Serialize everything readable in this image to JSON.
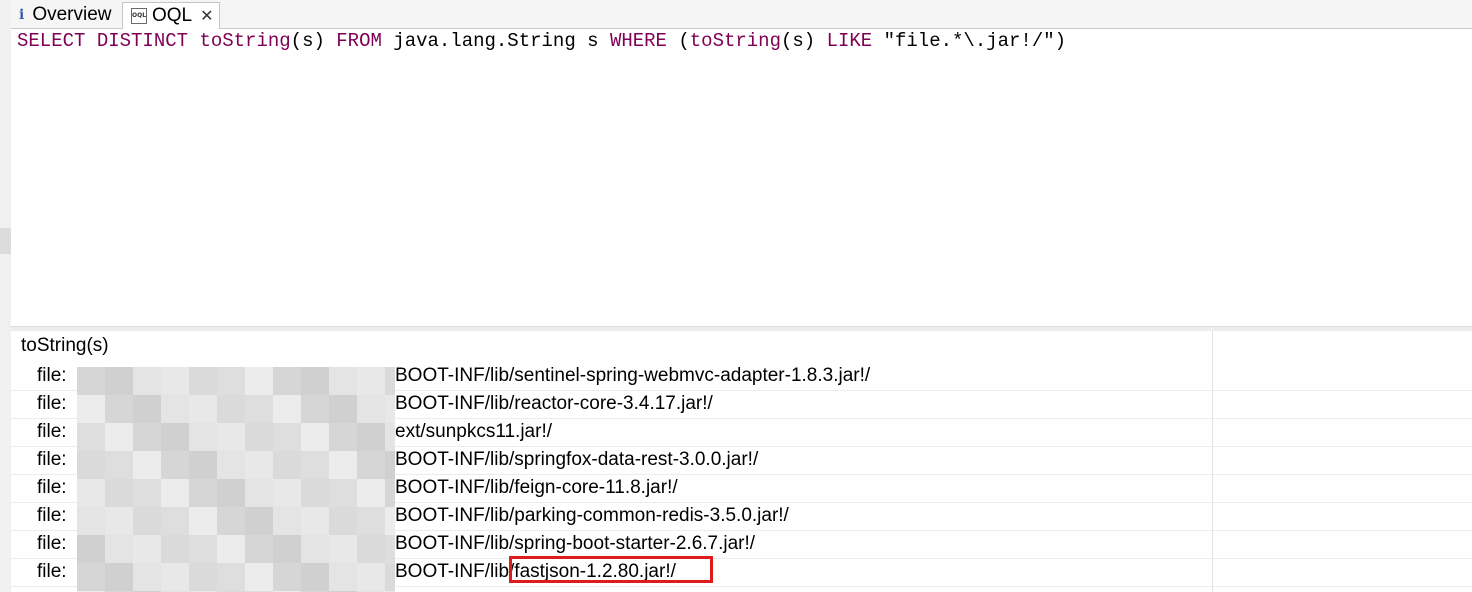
{
  "tabs": [
    {
      "label": "Overview",
      "icon": "info-icon",
      "active": false
    },
    {
      "label": "OQL",
      "icon": "oql-file-icon",
      "active": true,
      "closable": true
    }
  ],
  "editor": {
    "tokens": [
      {
        "text": "SELECT",
        "kind": "kw"
      },
      {
        "text": " ",
        "kind": "plain"
      },
      {
        "text": "DISTINCT",
        "kind": "kw"
      },
      {
        "text": " ",
        "kind": "plain"
      },
      {
        "text": "toString",
        "kind": "fn"
      },
      {
        "text": "(s) ",
        "kind": "plain"
      },
      {
        "text": "FROM",
        "kind": "kw"
      },
      {
        "text": " java.lang.String s ",
        "kind": "plain"
      },
      {
        "text": "WHERE",
        "kind": "kw"
      },
      {
        "text": " (",
        "kind": "plain"
      },
      {
        "text": "toString",
        "kind": "fn"
      },
      {
        "text": "(s) ",
        "kind": "plain"
      },
      {
        "text": "LIKE",
        "kind": "kw"
      },
      {
        "text": " \"file.*\\.jar!/\")",
        "kind": "str"
      }
    ]
  },
  "results": {
    "column_header": "toString(s)",
    "rows": [
      {
        "prefix": "file:",
        "value": "BOOT-INF/lib/sentinel-spring-webmvc-adapter-1.8.3.jar!/"
      },
      {
        "prefix": "file:",
        "value": "BOOT-INF/lib/reactor-core-3.4.17.jar!/"
      },
      {
        "prefix": "file:",
        "value": "ext/sunpkcs11.jar!/"
      },
      {
        "prefix": "file:",
        "value": "BOOT-INF/lib/springfox-data-rest-3.0.0.jar!/"
      },
      {
        "prefix": "file:",
        "value": "BOOT-INF/lib/feign-core-11.8.jar!/"
      },
      {
        "prefix": "file:",
        "value": "BOOT-INF/lib/parking-common-redis-3.5.0.jar!/"
      },
      {
        "prefix": "file:",
        "value": "BOOT-INF/lib/spring-boot-starter-2.6.7.jar!/"
      },
      {
        "prefix": "file:",
        "value": "BOOT-INF/lib/fastjson-1.2.80.jar!/",
        "highlighted": true
      }
    ]
  },
  "colors": {
    "keyword": "#7f0055",
    "highlight_border": "#e01b1b"
  }
}
